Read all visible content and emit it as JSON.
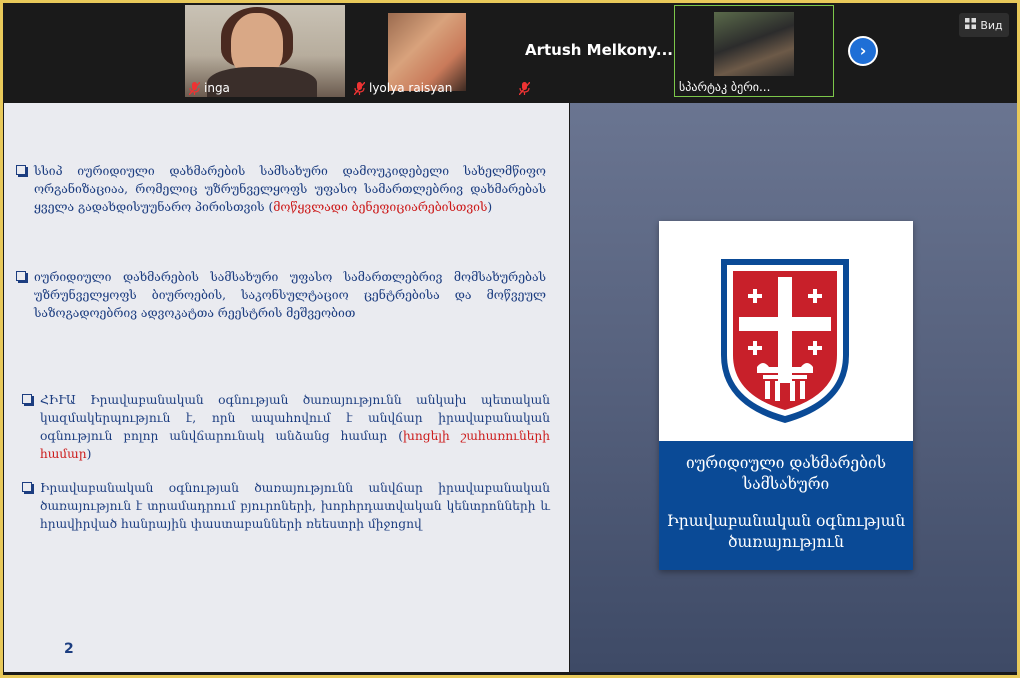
{
  "participants": [
    {
      "name": "inga",
      "muted": true
    },
    {
      "name": "lyolya raisyan",
      "muted": true
    },
    {
      "name": "Artush  Melkony...",
      "muted": true
    },
    {
      "name": "სპარტაკ ბერი...",
      "muted": false
    }
  ],
  "toolbar": {
    "view_label": "Вид",
    "next_icon": "chevron-right-icon"
  },
  "slide": {
    "bullets": [
      {
        "text": "სსიპ იურიდიული დახმარების სამსახური დამოუკიდებელი სახელმწიფო ორგანიზაციაა, რომელიც უზრუნველყოფს უფასო სამართლებრივ დახმარებას ყველა გადახდისუუნარო პირისთვის (",
        "highlight": "მოწყვლადი ბენეფიციარებისთვის",
        "tail": ")"
      },
      {
        "text": "იურიდიული დახმარების სამსახური უფასო სამართლებრივ მომსახურებას უზრუნველყოფს ბიუროების, საკონსულტაციო ცენტრებისა და მოწვეულ საზოგადოებრივ ადვოკატთა რეესტრის მეშვეობით",
        "highlight": "",
        "tail": ""
      },
      {
        "text": "ՀԻՒԱ Իրավաբանական օգնության ծառայությունն անկախ պետական կազմակերպություն է, որն ապահովում է անվճար իրավաբանական օգնություն բոլոր անվճարունակ անձանց համար (",
        "highlight": "խոցելի շահառուների համար",
        "tail": ")"
      },
      {
        "text": "Իրավաբանական օգնության ծառայությունն անվճար իրավաբանական ծառայություն է տրամադրում բյուրոների, խորհրդատվական կենտրոնների և հրավիրված հանրային փաստաբանների ռեեստրի միջոցով",
        "highlight": "",
        "tail": ""
      }
    ],
    "page_number": "2",
    "card": {
      "title_georgian": "იურიდიული დახმარების სამსახური",
      "title_armenian": "Իրավաբանական օգնության ծառայություն"
    }
  },
  "colors": {
    "accent_blue": "#0a4a96",
    "text_blue": "#1c3d80",
    "highlight_red": "#cc1a1a",
    "emblem_red": "#c8202a"
  }
}
